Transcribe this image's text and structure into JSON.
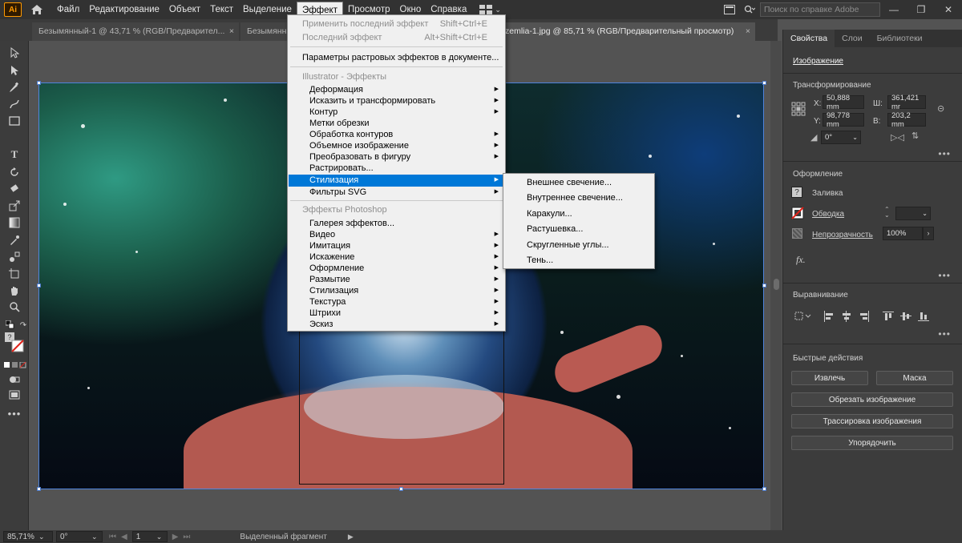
{
  "app": {
    "logo_text": "Ai"
  },
  "menubar": {
    "items": [
      "Файл",
      "Редактирование",
      "Объект",
      "Текст",
      "Выделение",
      "Эффект",
      "Просмотр",
      "Окно",
      "Справка"
    ],
    "active": "Эффект",
    "search_placeholder": "Поиск по справке Adobe"
  },
  "tabs": [
    {
      "label": "Безымянный-1 @ 43,71 % (RGB/Предварител...",
      "active": false
    },
    {
      "label": "Безымянн",
      "active": false
    },
    {
      "label": "zemlia-1.jpg @ 85,71 % (RGB/Предварительный просмотр)",
      "active": true
    }
  ],
  "effect_menu": {
    "apply_last": {
      "label": "Применить последний эффект",
      "shortcut": "Shift+Ctrl+E"
    },
    "last_effect": {
      "label": "Последний эффект",
      "shortcut": "Alt+Shift+Ctrl+E"
    },
    "raster_settings": "Параметры растровых эффектов в документе...",
    "illustrator_heading": "Illustrator - Эффекты",
    "illustrator_items": [
      {
        "label": "Деформация",
        "submenu": true
      },
      {
        "label": "Исказить и трансформировать",
        "submenu": true
      },
      {
        "label": "Контур",
        "submenu": true
      },
      {
        "label": "Метки обрезки",
        "submenu": false
      },
      {
        "label": "Обработка контуров",
        "submenu": true
      },
      {
        "label": "Объемное изображение",
        "submenu": true
      },
      {
        "label": "Преобразовать в фигуру",
        "submenu": true
      },
      {
        "label": "Растрировать...",
        "submenu": false
      },
      {
        "label": "Стилизация",
        "submenu": true,
        "highlighted": true
      },
      {
        "label": "Фильтры SVG",
        "submenu": true
      }
    ],
    "photoshop_heading": "Эффекты Photoshop",
    "photoshop_items": [
      {
        "label": "Галерея эффектов...",
        "submenu": false
      },
      {
        "label": "Видео",
        "submenu": true
      },
      {
        "label": "Имитация",
        "submenu": true
      },
      {
        "label": "Искажение",
        "submenu": true
      },
      {
        "label": "Оформление",
        "submenu": true
      },
      {
        "label": "Размытие",
        "submenu": true
      },
      {
        "label": "Стилизация",
        "submenu": true
      },
      {
        "label": "Текстура",
        "submenu": true
      },
      {
        "label": "Штрихи",
        "submenu": true
      },
      {
        "label": "Эскиз",
        "submenu": true
      }
    ]
  },
  "stylize_submenu": [
    "Внешнее свечение...",
    "Внутреннее свечение...",
    "Каракули...",
    "Растушевка...",
    "Скругленные углы...",
    "Тень..."
  ],
  "panel": {
    "tabs": [
      "Свойства",
      "Слои",
      "Библиотеки"
    ],
    "object_type": "Изображение",
    "transform": {
      "title": "Трансформирование",
      "x_label": "X:",
      "x": "50,888 mm",
      "w_label": "Ш:",
      "w": "361,421 mr",
      "y_label": "Y:",
      "y": "98,778 mm",
      "h_label": "В:",
      "h": "203,2 mm",
      "angle": "0°"
    },
    "appearance": {
      "title": "Оформление",
      "fill": "Заливка",
      "stroke": "Обводка",
      "opacity_label": "Непрозрачность",
      "opacity": "100%",
      "fx": "fx."
    },
    "align": {
      "title": "Выравнивание"
    },
    "quick_actions": {
      "title": "Быстрые действия",
      "extract": "Извлечь",
      "mask": "Маска",
      "crop": "Обрезать изображение",
      "trace": "Трассировка изображения",
      "arrange": "Упорядочить"
    }
  },
  "status": {
    "zoom": "85,71%",
    "rotation": "0°",
    "artboard": "1",
    "selection_text": "Выделенный фрагмент"
  }
}
